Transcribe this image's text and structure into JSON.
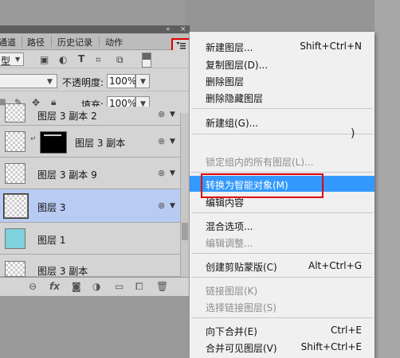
{
  "panel": {
    "mini_left": "«",
    "mini_right": "×",
    "tabs": [
      "通道",
      "路径",
      "历史记录",
      "动作"
    ],
    "filter_value": "型",
    "blend_mode": "",
    "opacity_label": "不透明度:",
    "opacity_value": "100%",
    "lock_label": "锁",
    "fill_label": "填充:",
    "fill_value": "100%",
    "colors": {
      "selected_row": "#b8cbf2",
      "red_highlight": "#e00000"
    }
  },
  "layers": [
    {
      "name": "图层 3 副本 2"
    },
    {
      "name": "图层 3 副本"
    },
    {
      "name": "图层 3 副本 9"
    },
    {
      "name": "图层 3",
      "selected": true
    },
    {
      "name": "图层 1"
    },
    {
      "name": "图层 3 副本"
    }
  ],
  "menu": {
    "items": [
      {
        "label": "新建图层...",
        "shortcut": "Shift+Ctrl+N"
      },
      {
        "label": "复制图层(D)...",
        "shortcut": ""
      },
      {
        "label": "删除图层",
        "shortcut": ""
      },
      {
        "label": "删除隐藏图层",
        "shortcut": ""
      },
      {
        "label": "新建组(G)...",
        "shortcut": ""
      },
      {
        "label": "锁定组内的所有图层(L)...",
        "shortcut": ""
      },
      {
        "label": "转换为智能对象(M)",
        "shortcut": ""
      },
      {
        "label": "编辑内容",
        "shortcut": ""
      },
      {
        "label": "混合选项...",
        "shortcut": ""
      },
      {
        "label": "编辑调整...",
        "shortcut": ""
      },
      {
        "label": "创建剪贴蒙版(C)",
        "shortcut": "Alt+Ctrl+G"
      },
      {
        "label": "链接图层(K)",
        "shortcut": ""
      },
      {
        "label": "选择链接图层(S)",
        "shortcut": ""
      },
      {
        "label": "向下合并(E)",
        "shortcut": "Ctrl+E"
      },
      {
        "label": "合并可见图层(V)",
        "shortcut": "Shift+Ctrl+E"
      }
    ]
  }
}
